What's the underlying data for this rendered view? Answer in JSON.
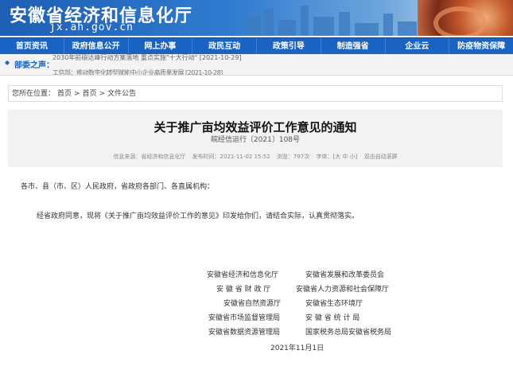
{
  "header": {
    "title": "安徽省经济和信息化厅",
    "url": "jx.ah.gov.cn"
  },
  "nav": [
    "首页资讯",
    "政府信息公开",
    "网上办事",
    "政民互动",
    "政策引导",
    "制造强省",
    "企业云",
    "防疫物资保障"
  ],
  "notice": {
    "label": "部委之声：",
    "line1": "2030年前碳达峰行动方案落地 重点实施\"十大行动\" [2021-10-29]",
    "line2": "工信部：推动数字化转型赋能中小企业高质量发展 [2021-10-28]"
  },
  "breadcrumb": {
    "label": "您所在位置：",
    "items": [
      "首页",
      "首页",
      "文件公告"
    ],
    "sep": ">"
  },
  "article": {
    "title": "关于推广亩均效益评价工作意见的通知",
    "doc_number": "皖经信运行〔2021〕108号",
    "meta_source": "信息来源：省经济和信息化厅",
    "meta_time": "发布时间：2021-11-02 15:52",
    "meta_views": "浏览：797次",
    "meta_font": "字体：[大 中 小]",
    "meta_scroll": "双击自动滚屏",
    "addressee": "各市、县（市、区）人民政府，省政府各部门、各直属机构：",
    "content": "经省政府同意，现将《关于推广亩均效益评价工作的意见》印发给你们，请结合实际，认真贯彻落实。",
    "signatures": [
      [
        "安徽省经济和信息化厅",
        "安徽省发展和改革委员会"
      ],
      [
        "安 徽 省 财 政 厅",
        "安徽省人力资源和社会保障厅"
      ],
      [
        "安徽省自然资源厅",
        "安徽省生态环境厅"
      ],
      [
        "安徽省市场监督管理局",
        "安 徽 省 统 计 局"
      ],
      [
        "安徽省数据资源管理局",
        "国家税务总局安徽省税务局"
      ]
    ],
    "date": "2021年11月1日"
  },
  "colors": {
    "nav_bg": "#1a63c2",
    "accent": "#1a63c2"
  }
}
